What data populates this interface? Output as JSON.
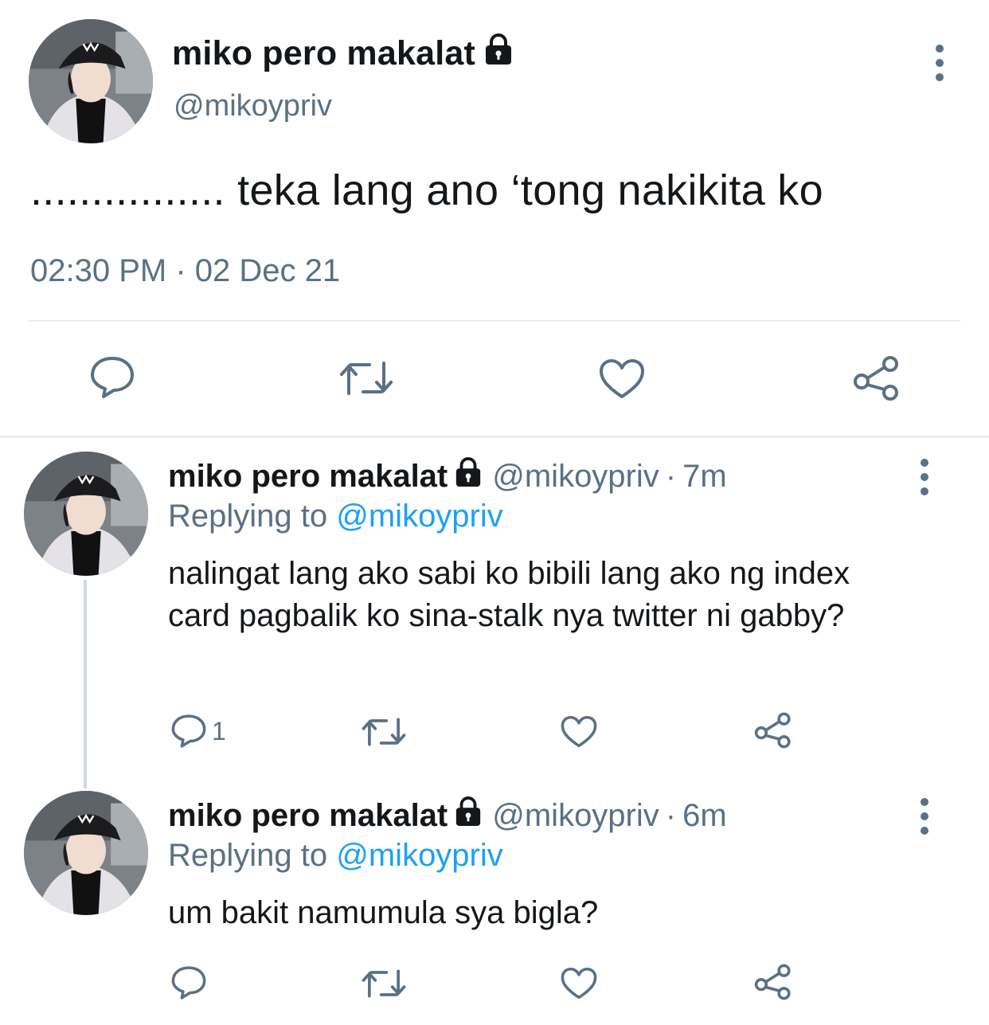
{
  "main_tweet": {
    "display_name": "miko pero makalat",
    "handle": "@mikoypriv",
    "text": "................ teka lang ano ‘tong nakikita ko",
    "timestamp": "02:30 PM · 02 Dec 21",
    "actions": [
      "reply-icon",
      "retweet-icon",
      "like-icon",
      "share-icon"
    ]
  },
  "replies": [
    {
      "display_name": "miko pero makalat",
      "handle": "@mikoypriv",
      "separator": "·",
      "time": "7m",
      "replying_prefix": "Replying to",
      "replying_to": "@mikoypriv",
      "text": "nalingat lang ako sabi ko bibili lang ako ng index card pagbalik ko sina-stalk nya twitter ni gabby?",
      "reply_count": "1"
    },
    {
      "display_name": "miko pero makalat",
      "handle": "@mikoypriv",
      "separator": "·",
      "time": "6m",
      "replying_prefix": "Replying to",
      "replying_to": "@mikoypriv",
      "text": "um bakit namumula sya bigla?",
      "reply_count": ""
    }
  ],
  "colors": {
    "text_primary": "#14171a",
    "text_secondary": "#5b7083",
    "link": "#1da1f2",
    "divider": "#e6ecf0"
  }
}
